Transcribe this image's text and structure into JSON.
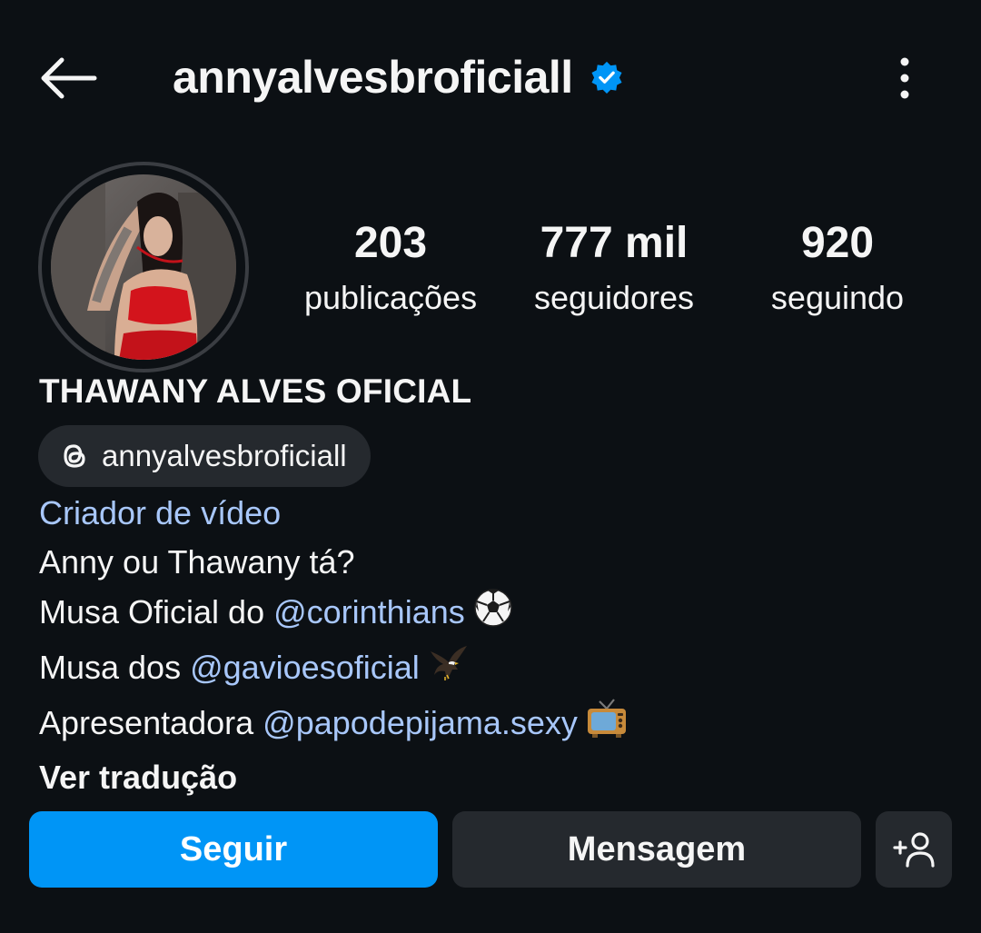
{
  "header": {
    "username": "annyalvesbroficiall",
    "verified": true,
    "back_icon": "arrow-left-icon",
    "more_icon": "kebab-menu-icon"
  },
  "stats": [
    {
      "value": "203",
      "label": "publicações"
    },
    {
      "value": "777 mil",
      "label": "seguidores"
    },
    {
      "value": "920",
      "label": "seguindo"
    }
  ],
  "profile": {
    "full_name": "THAWANY ALVES OFICIAL",
    "threads_handle": "annyalvesbroficiall",
    "category": "Criador de vídeo",
    "bio": {
      "line1": "Anny ou Thawany tá?",
      "line2_prefix": "Musa Oficial do ",
      "line2_mention": "@corinthians",
      "line2_emoji": "soccer-ball-icon",
      "line3_prefix": "Musa dos ",
      "line3_mention": "@gavioesoficial",
      "line3_emoji": "eagle-icon",
      "line4_prefix": "Apresentadora ",
      "line4_mention": "@papodepijama.sexy",
      "line4_emoji": "television-icon",
      "translate": "Ver tradução"
    }
  },
  "actions": {
    "follow": "Seguir",
    "message": "Mensagem",
    "add_user_icon": "add-person-icon"
  },
  "colors": {
    "background": "#0c1014",
    "primary_blue": "#0095f6",
    "link_blue": "#a8c7fa",
    "secondary_button": "#25292e",
    "verified_badge": "#0095f6"
  }
}
